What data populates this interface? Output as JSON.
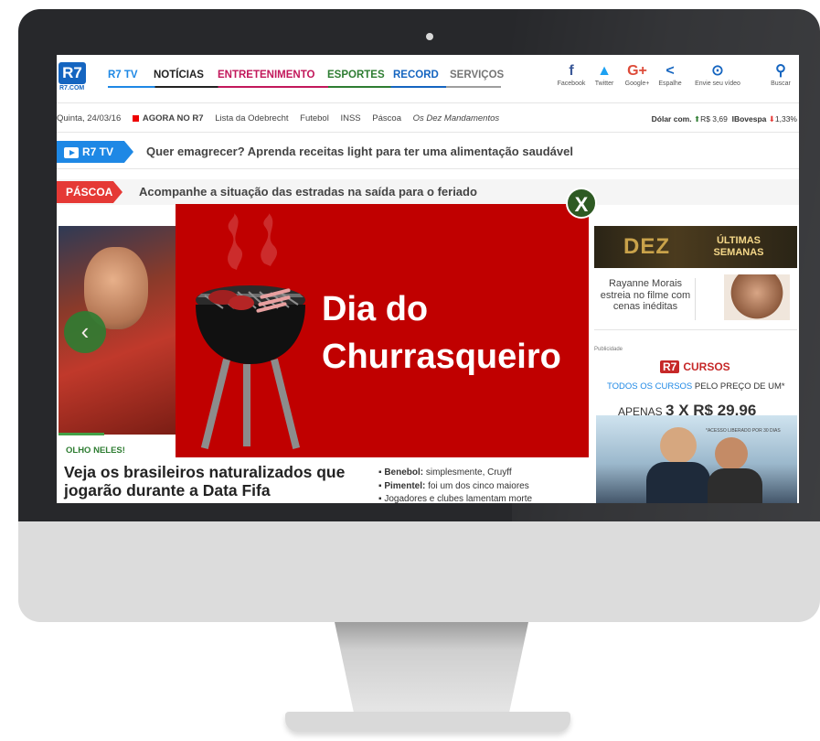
{
  "site": {
    "logo": "R7",
    "logo_sub": "R7.COM",
    "nav": [
      {
        "label": "R7 TV",
        "color": "#1e88e5"
      },
      {
        "label": "NOTÍCIAS",
        "color": "#222222"
      },
      {
        "label": "ENTRETENIMENTO",
        "color": "#c2185b"
      },
      {
        "label": "ESPORTES",
        "color": "#2e7d32"
      },
      {
        "label": "RECORD",
        "color": "#1565c0"
      },
      {
        "label": "SERVIÇOS",
        "color": "#757575"
      }
    ],
    "social": [
      {
        "icon": "facebook-icon",
        "glyph": "f",
        "label": "Facebook",
        "color": "#3b5998"
      },
      {
        "icon": "twitter-icon",
        "glyph": "🐦",
        "label": "Twitter",
        "color": "#1da1f2"
      },
      {
        "icon": "googleplus-icon",
        "glyph": "G+",
        "label": "Google+",
        "color": "#dd4b39"
      },
      {
        "icon": "share-icon",
        "glyph": "<",
        "label": "Espalhe",
        "color": "#1565c0"
      },
      {
        "icon": "upload-icon",
        "glyph": "⊙",
        "label": "Envie seu vídeo",
        "color": "#1565c0"
      },
      {
        "icon": "search-icon",
        "glyph": "⚲",
        "label": "Buscar",
        "color": "#1565c0"
      }
    ]
  },
  "subbar": {
    "date": "Quinta, 24/03/16",
    "agora": "AGORA NO R7",
    "links": [
      "Lista da Odebrecht",
      "Futebol",
      "INSS",
      "Páscoa",
      "Os Dez Mandamentos"
    ],
    "dolar_label": "Dólar com.",
    "dolar_value": "R$ 3,69",
    "ibovespa_label": "IBovespa",
    "ibovespa_value": "1,33%"
  },
  "tickers": {
    "r7tv_tag": "R7 TV",
    "r7tv_text": "Quer emagrecer? Aprenda receitas light para ter uma alimentação saudável",
    "pascoa_tag": "PÁSCOA",
    "pascoa_text": "Acompanhe a situação das estradas na saída para o feriado"
  },
  "main": {
    "category": "OLHO NELES!",
    "headline": "Veja os brasileiros naturalizados que jogarão durante a Data Fifa",
    "bullets": [
      {
        "bold": "Benebol:",
        "text": " simplesmente, Cruyff"
      },
      {
        "bold": "Pimentel:",
        "text": " foi um dos cinco maiores"
      },
      {
        "bold": "",
        "text": "Jogadores e clubes lamentam morte"
      }
    ]
  },
  "sidebar": {
    "banner_title": "DEZ",
    "banner_tag": "ÚLTIMAS SEMANAS",
    "promo_text": "Rayanne Morais estreia no filme com cenas inéditas",
    "publicidade": "Publicidade",
    "cursos_logo": "R7",
    "cursos_label": "CURSOS",
    "todos_a": "TODOS OS CURSOS",
    "todos_b": " PELO PREÇO DE UM*",
    "apenas_a": "APENAS ",
    "apenas_b": "3 X R$ 29,96",
    "acesso": "*ACESSO LIBERADO POR 30 DIAS"
  },
  "popup": {
    "title_line1": "Dia do",
    "title_line2": "Churrasqueiro",
    "close_label": "X",
    "bg_color": "#c00000",
    "close_color": "#2e5a23"
  }
}
